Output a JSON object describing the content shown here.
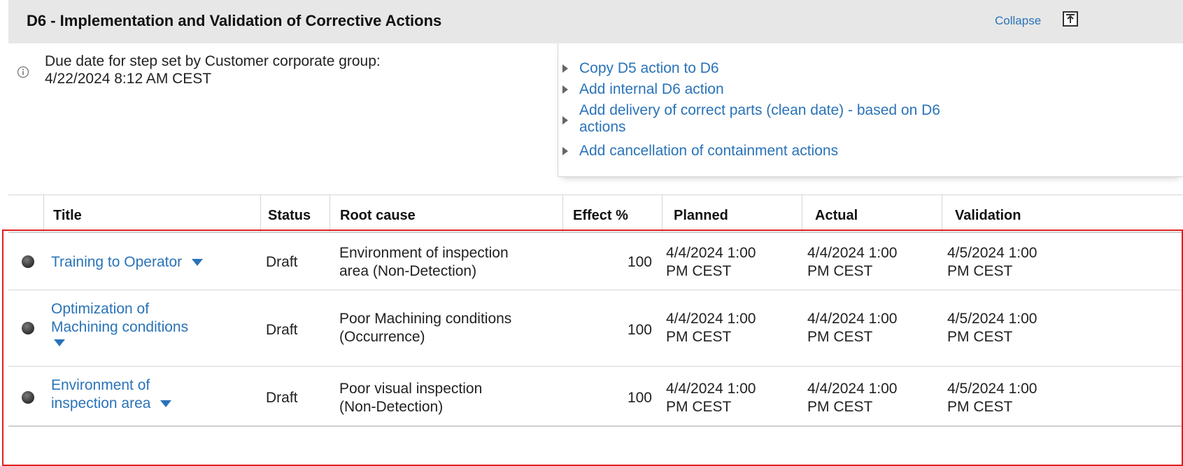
{
  "header": {
    "title": "D6 - Implementation and Validation of Corrective Actions",
    "collapse_label": "Collapse"
  },
  "info": {
    "due_label": "Due date for step set by Customer corporate group:",
    "due_value": "4/22/2024 8:12 AM CEST"
  },
  "actions": [
    {
      "label": "Copy D5 action to D6"
    },
    {
      "label": "Add internal D6 action"
    },
    {
      "label_line1": "Add delivery of correct parts (clean date) - based on D6",
      "label_line2": "actions"
    },
    {
      "label": "Add cancellation of containment actions"
    }
  ],
  "table": {
    "columns": {
      "title": "Title",
      "status": "Status",
      "root_cause": "Root cause",
      "effect": "Effect %",
      "planned": "Planned",
      "actual": "Actual",
      "validation": "Validation"
    },
    "rows": [
      {
        "title_line1": "Training to Operator",
        "status": "Draft",
        "root_line1": "Environment of inspection",
        "root_line2": "area (Non-Detection)",
        "effect": "100",
        "planned_line1": "4/4/2024 1:00",
        "planned_line2": "PM CEST",
        "actual_line1": "4/4/2024 1:00",
        "actual_line2": "PM CEST",
        "validation_line1": "4/5/2024 1:00",
        "validation_line2": "PM CEST"
      },
      {
        "title_line1": "Optimization of",
        "title_line2": "Machining conditions",
        "status": "Draft",
        "root_line1": "Poor Machining conditions",
        "root_line2": "(Occurrence)",
        "effect": "100",
        "planned_line1": "4/4/2024 1:00",
        "planned_line2": "PM CEST",
        "actual_line1": "4/4/2024 1:00",
        "actual_line2": "PM CEST",
        "validation_line1": "4/5/2024 1:00",
        "validation_line2": "PM CEST"
      },
      {
        "title_line1": "Environment of",
        "title_line2": "inspection area",
        "status": "Draft",
        "root_line1": "Poor visual inspection",
        "root_line2": "(Non-Detection)",
        "effect": "100",
        "planned_line1": "4/4/2024 1:00",
        "planned_line2": "PM CEST",
        "actual_line1": "4/4/2024 1:00",
        "actual_line2": "PM CEST",
        "validation_line1": "4/5/2024 1:00",
        "validation_line2": "PM CEST"
      }
    ]
  },
  "colors": {
    "link": "#2a73b8",
    "header_bg": "#e7e7e7",
    "selection": "#e02020"
  }
}
